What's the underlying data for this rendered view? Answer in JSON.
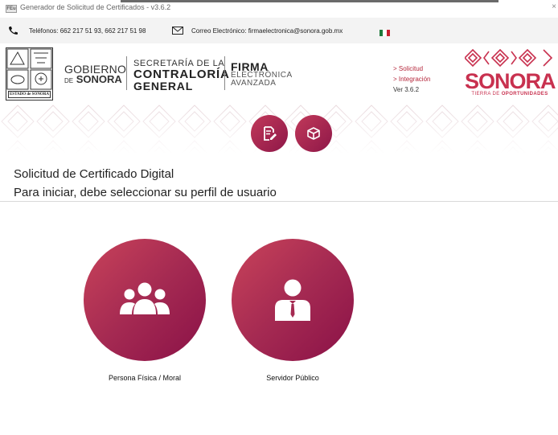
{
  "window": {
    "app_icon_text": "FEu",
    "title": "Generador de Solicitud de Certificados - v3.6.2",
    "close_glyph": "×"
  },
  "contact": {
    "phones": "Teléfonos: 662 217 51 93, 662 217 51 98",
    "email": "Correo Electrónico: firmaelectronica@sonora.gob.mx",
    "flag_colors": [
      "#1e7a3c",
      "#ffffff",
      "#c8202f"
    ]
  },
  "header": {
    "seal_ribbon": "ESTADO de SONORA",
    "gobierno_line1": "GOBIERNO",
    "gobierno_de": "DE",
    "gobierno_sonora": "SONORA",
    "secretaria_line1": "SECRETARÍA DE LA",
    "secretaria_line2": "CONTRALORÍA",
    "secretaria_line3": "GENERAL",
    "firma_line1": "FIRMA",
    "firma_line2": "ELECTRÓNICA",
    "firma_line3": "AVANZADA",
    "links": [
      "> Solicitud",
      "> Integración"
    ],
    "version": "Ver 3.6.2",
    "brand_word": "SONORA",
    "brand_tag_part1": "TIERRA DE",
    "brand_tag_part2": "OPORTUNIDADES"
  },
  "toolbar": {
    "edit_icon": "document-edit-icon",
    "cube_icon": "cube-icon"
  },
  "main": {
    "heading": "Solicitud de Certificado Digital",
    "subheading": "Para iniciar, debe seleccionar su perfil de usuario",
    "profiles": [
      {
        "label": "Persona Física / Moral",
        "icon": "group-users-icon"
      },
      {
        "label": "Servidor Público",
        "icon": "user-suit-icon"
      }
    ]
  },
  "colors": {
    "accent": "#b5283c",
    "gradient_start": "#c9435a",
    "gradient_end": "#8a1147",
    "brand": "#c8314f"
  }
}
